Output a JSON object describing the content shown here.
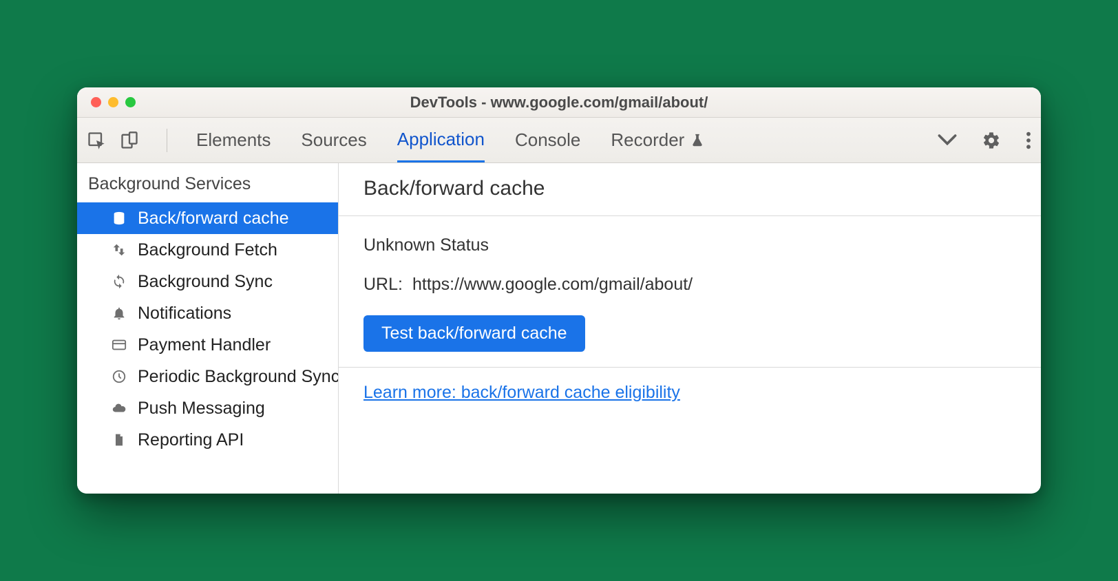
{
  "window": {
    "title": "DevTools - www.google.com/gmail/about/"
  },
  "tabs": {
    "items": [
      "Elements",
      "Sources",
      "Application",
      "Console",
      "Recorder"
    ],
    "active": "Application"
  },
  "sidebar": {
    "header": "Background Services",
    "items": [
      {
        "label": "Back/forward cache",
        "icon": "database-icon",
        "selected": true
      },
      {
        "label": "Background Fetch",
        "icon": "updown-icon",
        "selected": false
      },
      {
        "label": "Background Sync",
        "icon": "sync-icon",
        "selected": false
      },
      {
        "label": "Notifications",
        "icon": "bell-icon",
        "selected": false
      },
      {
        "label": "Payment Handler",
        "icon": "card-icon",
        "selected": false
      },
      {
        "label": "Periodic Background Sync",
        "icon": "clock-icon",
        "selected": false
      },
      {
        "label": "Push Messaging",
        "icon": "cloud-icon",
        "selected": false
      },
      {
        "label": "Reporting API",
        "icon": "file-icon",
        "selected": false
      }
    ]
  },
  "panel": {
    "heading": "Back/forward cache",
    "status": "Unknown Status",
    "url_label": "URL:",
    "url_value": "https://www.google.com/gmail/about/",
    "test_button": "Test back/forward cache",
    "learn_more": "Learn more: back/forward cache eligibility"
  }
}
